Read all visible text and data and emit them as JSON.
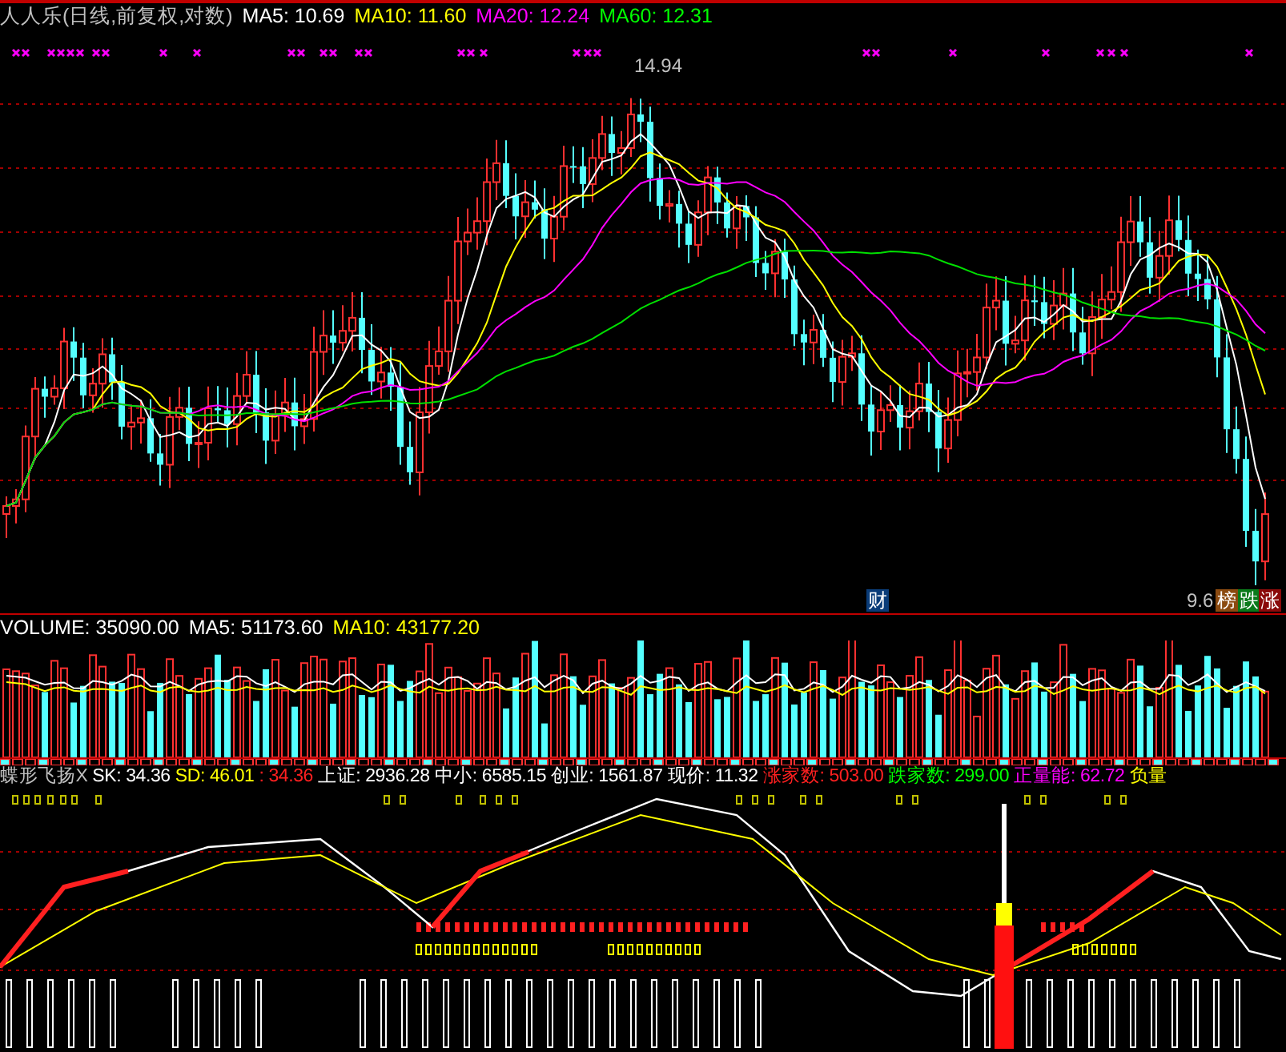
{
  "price_header": [
    {
      "text": "人人乐(日线,前复权,对数)",
      "color": "#c0c0c0"
    },
    {
      "text": "MA5: 10.69",
      "color": "#ffffff"
    },
    {
      "text": "MA10: 11.60",
      "color": "#ffff00"
    },
    {
      "text": "MA20: 12.24",
      "color": "#ff00ff"
    },
    {
      "text": "MA60: 12.31",
      "color": "#00ff00"
    }
  ],
  "price_chart": {
    "high_label": "14.94",
    "low_label": "9.6",
    "badges": [
      {
        "text": "财",
        "color": "#0a3c78"
      },
      {
        "text": "榜",
        "color": "#8b4a10"
      },
      {
        "text": "跌",
        "color": "#0a7a1a"
      },
      {
        "text": "涨",
        "color": "#8a0a0a"
      }
    ]
  },
  "volume_header": [
    {
      "text": "VOLUME: 35090.00",
      "color": "#ffffff"
    },
    {
      "text": "MA5: 51173.60",
      "color": "#ffffff"
    },
    {
      "text": "MA10: 43177.20",
      "color": "#ffff00"
    }
  ],
  "indicator_header": [
    {
      "text": "蝶形飞扬X",
      "color": "#c0c0c0"
    },
    {
      "text": "SK: 34.36",
      "color": "#ffffff"
    },
    {
      "text": "SD: 46.01",
      "color": "#ffff00"
    },
    {
      "text": ": 34.36",
      "color": "#ff2020"
    },
    {
      "text": "上证: 2936.28",
      "color": "#ffffff"
    },
    {
      "text": "中小: 6585.15",
      "color": "#ffffff"
    },
    {
      "text": "创业: 1561.87",
      "color": "#ffffff"
    },
    {
      "text": "现价: 11.32",
      "color": "#ffffff"
    },
    {
      "text": "涨家数: 503.00",
      "color": "#ff2020"
    },
    {
      "text": "跌家数: 299.00",
      "color": "#00ff00"
    },
    {
      "text": "正量能: 62.72",
      "color": "#ff00ff"
    },
    {
      "text": "负量",
      "color": "#ffff00"
    }
  ]
}
